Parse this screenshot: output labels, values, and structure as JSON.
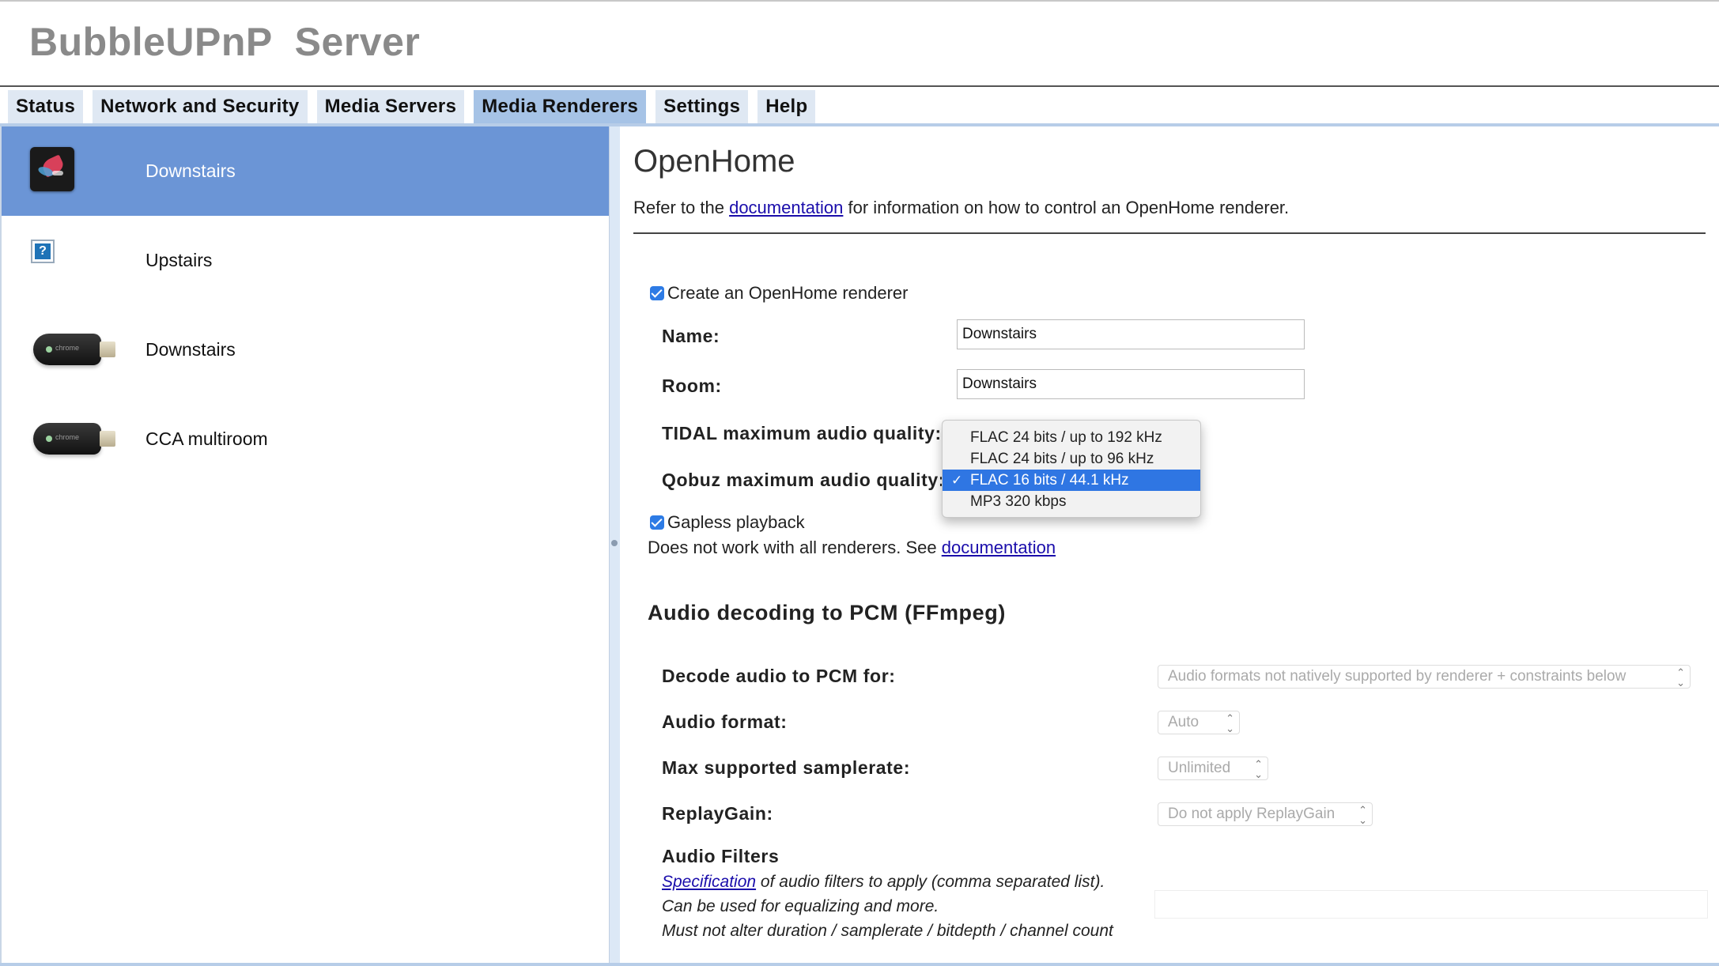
{
  "app": {
    "title": "BubbleUPnP  Server"
  },
  "tabs": [
    {
      "label": "Status",
      "active": false
    },
    {
      "label": "Network and Security",
      "active": false
    },
    {
      "label": "Media Servers",
      "active": false
    },
    {
      "label": "Media Renderers",
      "active": true
    },
    {
      "label": "Settings",
      "active": false
    },
    {
      "label": "Help",
      "active": false
    }
  ],
  "renderers": [
    {
      "label": "Downstairs",
      "icon": "app-icon",
      "selected": true
    },
    {
      "label": "Upstairs",
      "icon": "unknown-device-icon",
      "selected": false
    },
    {
      "label": "Downstairs",
      "icon": "chromecast-icon",
      "selected": false
    },
    {
      "label": "CCA multiroom",
      "icon": "chromecast-icon",
      "selected": false
    }
  ],
  "openhome": {
    "title": "OpenHome",
    "intro_before": "Refer to the ",
    "intro_link": "documentation",
    "intro_after": " for information on how to control an OpenHome renderer.",
    "create_label": "Create an OpenHome renderer",
    "create_checked": true,
    "name_label": "Name:",
    "name_value": "Downstairs",
    "room_label": "Room:",
    "room_value": "Downstairs",
    "tidal_label": "TIDAL maximum audio quality:",
    "qobuz_label": "Qobuz maximum audio quality:",
    "gapless_label": "Gapless playback",
    "gapless_checked": true,
    "gapless_note_before": "Does not work with all renderers. See ",
    "gapless_note_link": "documentation"
  },
  "quality_dropdown": {
    "options": [
      "FLAC 24 bits / up to 192 kHz",
      "FLAC 24 bits / up to 96 kHz",
      "FLAC 16 bits / 44.1 kHz",
      "MP3 320 kbps"
    ],
    "selected": "FLAC 16 bits / 44.1 kHz",
    "check": "✓"
  },
  "ffmpeg": {
    "title": "Audio decoding to PCM (FFmpeg)",
    "decode_label": "Decode audio to PCM for:",
    "decode_value": "Audio formats not natively supported by renderer + constraints below",
    "format_label": "Audio format:",
    "format_value": "Auto",
    "samplerate_label": "Max supported samplerate:",
    "samplerate_value": "Unlimited",
    "replaygain_label": "ReplayGain:",
    "replaygain_value": "Do not apply ReplayGain",
    "filters_title": "Audio Filters",
    "filters_link": "Specification",
    "filters_desc_1": " of audio filters to apply (comma separated list).",
    "filters_desc_2": "Can be used for equalizing and more.",
    "filters_desc_3": "Must not alter duration / samplerate / bitdepth / channel count",
    "filters_value": ""
  },
  "colors": {
    "selected_item": "#6b95d6",
    "active_tab": "#a6c3e6",
    "tab": "#dfe8f3",
    "checkbox": "#2d7be5",
    "dropdown_highlight": "#2f76e3",
    "link": "#1a0dab"
  }
}
